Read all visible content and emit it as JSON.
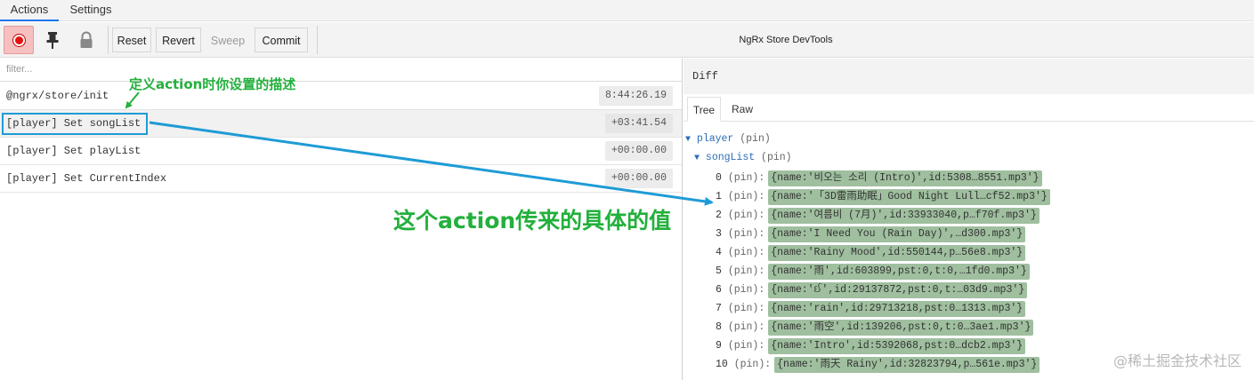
{
  "tabs": {
    "actions": "Actions",
    "settings": "Settings"
  },
  "toolbar": {
    "reset": "Reset",
    "revert": "Revert",
    "sweep": "Sweep",
    "commit": "Commit",
    "title": "NgRx Store DevTools",
    "record_icon": "record-icon",
    "pin_icon": "pin-icon",
    "lock_icon": "lock-icon"
  },
  "filter": {
    "placeholder": "filter..."
  },
  "actions": [
    {
      "name": "@ngrx/store/init",
      "time": "8:44:26.19"
    },
    {
      "name": "[player] Set songList",
      "time": "+03:41.54"
    },
    {
      "name": "[player] Set playList",
      "time": "+00:00.00"
    },
    {
      "name": "[player] Set CurrentIndex",
      "time": "+00:00.00"
    }
  ],
  "diff": {
    "header": "Diff",
    "tab_tree": "Tree",
    "tab_raw": "Raw",
    "root_key": "player",
    "child_key": "songList",
    "pin_label": "(pin)",
    "items": [
      {
        "idx": "0",
        "value": "{name:'비오는 소리 (Intro)',id:5308…8551.mp3'}"
      },
      {
        "idx": "1",
        "value": "{name:'「3D雷雨助眠」Good Night Lull…cf52.mp3'}"
      },
      {
        "idx": "2",
        "value": "{name:'여름비 (7月)',id:33933040,p…f70f.mp3'}"
      },
      {
        "idx": "3",
        "value": "{name:'I Need You (Rain Day)',…d300.mp3'}"
      },
      {
        "idx": "4",
        "value": "{name:'Rainy Mood',id:550144,p…56e8.mp3'}"
      },
      {
        "idx": "5",
        "value": "{name:'雨',id:603899,pst:0,t:0,…1fd0.mp3'}"
      },
      {
        "idx": "6",
        "value": "{name:'ઈ',id:29137872,pst:0,t:…03d9.mp3'}"
      },
      {
        "idx": "7",
        "value": "{name:'rain',id:29713218,pst:0…1313.mp3'}"
      },
      {
        "idx": "8",
        "value": "{name:'雨空',id:139206,pst:0,t:0…3ae1.mp3'}"
      },
      {
        "idx": "9",
        "value": "{name:'Intro',id:5392068,pst:0…dcb2.mp3'}"
      },
      {
        "idx": "10",
        "value": "{name:'雨天 Rainy',id:32823794,p…561e.mp3'}"
      }
    ]
  },
  "annotations": {
    "label1": "定义action时你设置的描述",
    "label2": "这个action传来的具体的值"
  },
  "watermark": "@稀土掘金技术社区",
  "colors": {
    "annotation": "#23b03c",
    "arrow": "#1e9bd6",
    "value_bg": "#9fbf9f",
    "tab_active": "#1a73e8"
  }
}
